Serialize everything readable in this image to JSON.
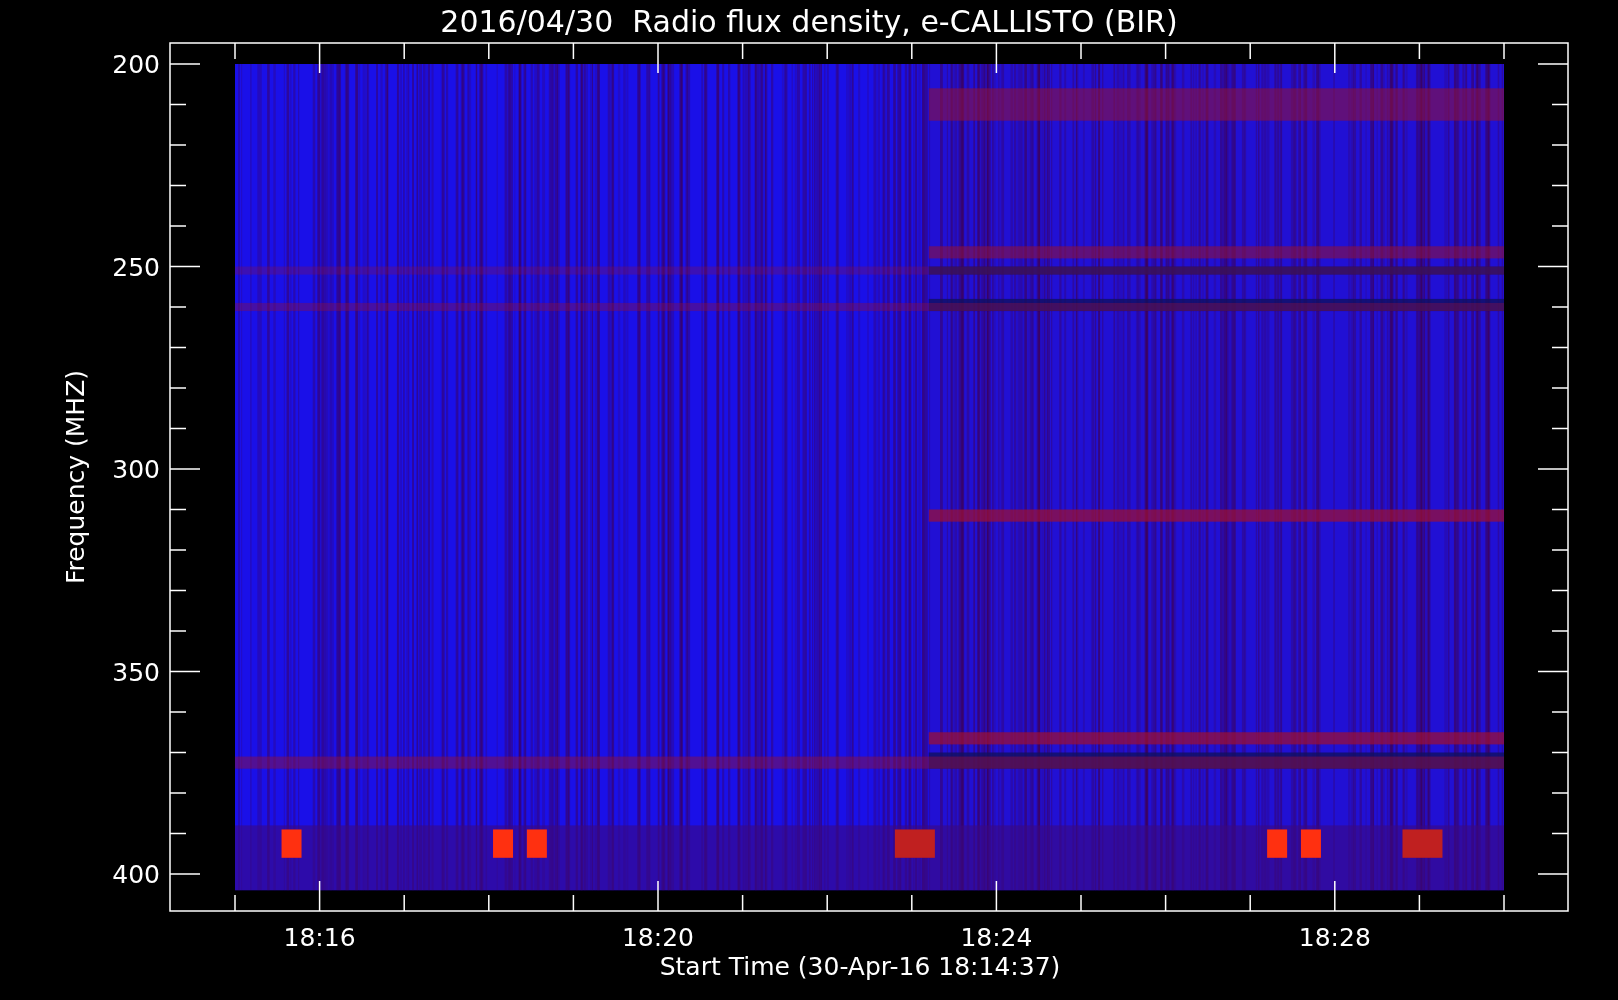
{
  "plot": {
    "title": "2016/04/30  Radio flux density, e-CALLISTO (BIR)",
    "ylabel": "Frequency (MHZ)",
    "xlabel": "Start Time (30-Apr-16 18:14:37)",
    "y_tick_labels": [
      "200",
      "250",
      "300",
      "350",
      "400"
    ],
    "x_tick_labels": [
      "18:16",
      "18:20",
      "18:24",
      "18:28"
    ]
  }
}
